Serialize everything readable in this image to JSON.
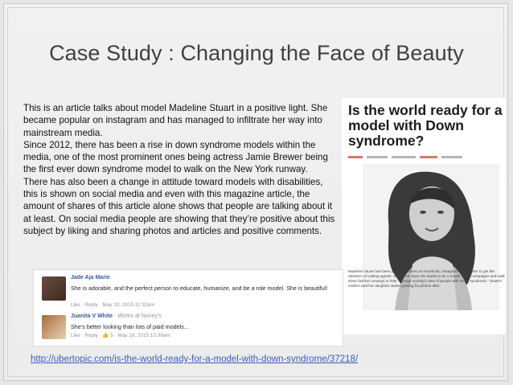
{
  "title": "Case Study : Changing the Face of Beauty",
  "body_paragraphs": [
    "This is an article talks about model Madeline Stuart in a positive light. She became popular on instagram and has managed to infiltrate her way into mainstream media.",
    "Since 2012, there has been a rise in down syndrome models within the media, one of the most prominent ones being actress Jamie Brewer being the first ever down syndrome model to walk on the New York runway.",
    "There has also been a change in attitude toward models with disabilities, this is shown on social media and even with this magazine article, the amount of shares of this article alone shows that people are talking about it at least. On social media people are showing that they’re positive about this subject by liking and sharing photos and articles and positive comments."
  ],
  "article": {
    "headline": "Is the world ready for a model with Down syndrome?",
    "caption": "Madeline Stuart has been posting pictures on Facebook, Instagram, and Twitter to get the attention of casting agents. Stuart, 18, says she wants to be a model on ad campaigns and walk down fashion runways to help \"change society's view of people with Down syndrome.\" Stuart's mother said her daughter started posing for photos after"
  },
  "comments": [
    {
      "name": "Jade Aja Marie",
      "works": "",
      "text": "She is adorable, and the perfect person to educate, humanize, and be a role model. She is beautiful!",
      "meta": "Like · Reply · May 19, 2015 11:32pm"
    },
    {
      "name": "Juanita V White",
      "works": " · Works at Noney's",
      "text": "She's better looking than lots of paid models...",
      "meta": "Like · Reply · 👍 5 · May 19, 2015 10:38am"
    }
  ],
  "source_link": "http://ubertopic.com/is-the-world-ready-for-a-model-with-down-syndrome/37218/",
  "colors": {
    "title": "#404040",
    "link": "#3b5db5",
    "facebook_name": "#3b5998"
  }
}
